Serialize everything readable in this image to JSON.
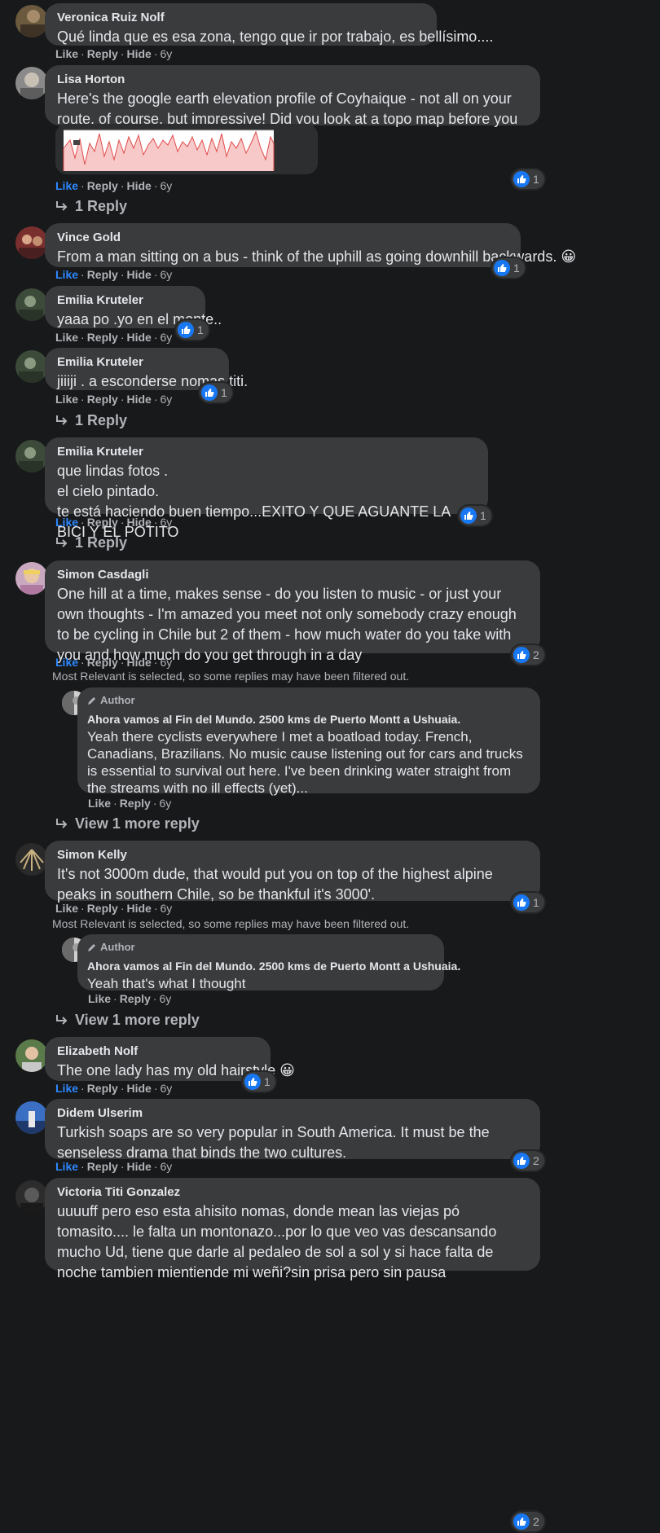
{
  "colors": {
    "background": "#18191a",
    "bubble": "#3a3b3c",
    "accent": "#2d88ff",
    "muted": "#b0b3b8"
  },
  "action_labels": {
    "like": "Like",
    "reply": "Reply",
    "hide": "Hide",
    "sep": "·"
  },
  "comments": [
    {
      "name": "Veronica Ruiz Nolf",
      "text": "Qué linda que es esa zona, tengo que ir por trabajo, es bellísimo....",
      "time": "6y"
    },
    {
      "name": "Lisa Horton",
      "text": "Here's the google earth elevation profile of Coyhaique - not all on your route, of course, but impressive! Did you look at a topo map before you planned this trip? 😮)",
      "time": "6y",
      "reactions": "1",
      "replies": "1 Reply"
    },
    {
      "name": "Vince Gold",
      "text": "From a man sitting on a bus - think of the uphill as going downhill backwards. 😀",
      "time": "6y",
      "reactions": "1"
    },
    {
      "name": "Emilia Kruteler",
      "text": "yaaa po .yo en el monte..",
      "time": "6y",
      "reactions": "1"
    },
    {
      "name": "Emilia Kruteler",
      "text": "jiiiji . a esconderse nomas titi.",
      "time": "6y",
      "reactions": "1",
      "replies": "1 Reply"
    },
    {
      "name": "Emilia Kruteler",
      "text": "que lindas fotos .\nel cielo pintado.\nte está haciendo buen tiempo...EXITO Y QUE AGUANTE LA BICI Y EL POTITO",
      "time": "6y",
      "reactions": "1",
      "replies": "1 Reply"
    },
    {
      "name": "Simon Casdagli",
      "text": "One hill at a time, makes sense - do you listen to music - or just your own thoughts - I'm amazed you meet not only somebody crazy enough to be cycling in Chile but 2 of them - how much water do you take with you and how much do you get through in a day",
      "time": "6y",
      "reactions": "2",
      "filter_note": "Most Relevant is selected, so some replies may have been filtered out.",
      "reply": {
        "badge": "Author",
        "name": "Ahora vamos al Fin del Mundo. 2500 kms de Puerto Montt a Ushuaia.",
        "text": "Yeah there cyclists everywhere I met a boatload today. French, Canadians, Brazilians. No music cause listening out for cars and trucks is essential to survival out here. I've been drinking water straight from the streams with no ill effects (yet)...",
        "time": "6y"
      },
      "more": "View 1 more reply"
    },
    {
      "name": "Simon Kelly",
      "text": "It's not 3000m dude, that would put you on top of the highest alpine peaks in southern Chile, so be thankful it's 3000'.",
      "time": "6y",
      "reactions": "1",
      "filter_note": "Most Relevant is selected, so some replies may have been filtered out.",
      "reply": {
        "badge": "Author",
        "name": "Ahora vamos al Fin del Mundo. 2500 kms de Puerto Montt a Ushuaia.",
        "text": "Yeah that's what I thought",
        "time": "6y"
      },
      "more": "View 1 more reply"
    },
    {
      "name": "Elizabeth Nolf",
      "text": "The one lady has my old hairstyle 😀",
      "time": "6y",
      "reactions": "1"
    },
    {
      "name": "Didem Ulserim",
      "text": "Turkish soaps are so very popular in South America. It must be the senseless drama that binds the two cultures.",
      "time": "6y",
      "reactions": "2"
    },
    {
      "name": "Victoria Titi Gonzalez",
      "text": "uuuuff pero eso esta ahisito nomas, donde mean las viejas pó tomasito.... le falta un montonazo...por lo que veo vas descansando mucho Ud, tiene que darle al pedaleo de sol a sol y si hace falta de noche tambien mientiende mi weñi?sin prisa pero sin pausa",
      "reactions": "2"
    }
  ]
}
